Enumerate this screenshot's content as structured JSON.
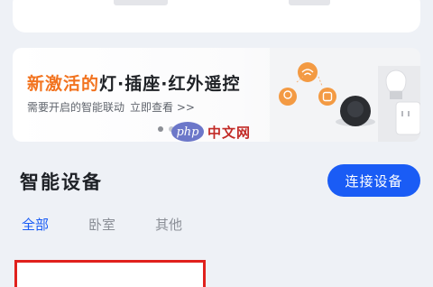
{
  "top_card": {
    "note": ""
  },
  "banner": {
    "title_highlight": "新激活的",
    "title_rest": "灯·插座·红外遥控",
    "subtitle": "需要开启的智能联动",
    "link": "立即查看 >>"
  },
  "watermark": {
    "logo": "php",
    "text": "中文网"
  },
  "section": {
    "title": "智能设备",
    "connect_button": "连接设备"
  },
  "tabs": [
    {
      "label": "全部",
      "active": true
    },
    {
      "label": "卧室",
      "active": false
    },
    {
      "label": "其他",
      "active": false
    }
  ],
  "colors": {
    "accent": "#1a5cf5",
    "highlight": "#f2731f",
    "annotation": "#e0211d"
  }
}
